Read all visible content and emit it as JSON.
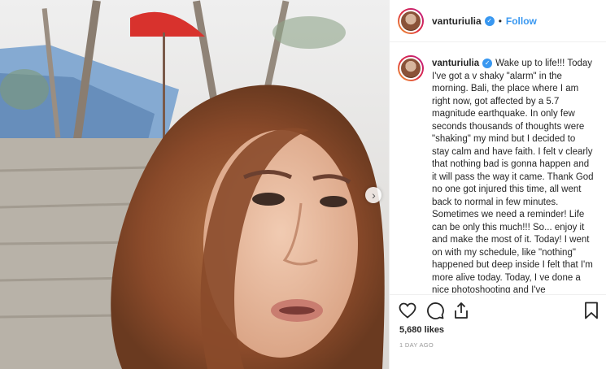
{
  "post": {
    "username": "vanturiulia",
    "follow_label": "Follow",
    "separator": "•",
    "verified_mark": "✓",
    "caption_user": "vanturiulia",
    "caption_text": "Wake up to life!!! Today I've got a v shaky \"alarm\" in the morning. Bali, the place where I am right now, got affected by a 5.7 magnitude earthquake. In only few seconds thousands of thoughts were \"shaking\" my mind but I decided to stay calm and have faith. I felt v clearly that nothing bad is gonna happen and it will pass the way it came. Thank God no one got injured this time, all went back to normal in few minutes. Sometimes we need a reminder! Life can be only this much!!! So... enjoy it and make the most of it. Today! I went on with my schedule, like \"nothing\" happened but deep inside I felt that I'm\nmore alive today. Today, I ve done a nice photoshooting and I've",
    "likes": "5,680 likes",
    "time": "1 DAY AGO"
  },
  "media": {
    "next_glyph": "›"
  },
  "icons": {
    "like": "heart-icon",
    "comment": "comment-icon",
    "share": "share-icon",
    "save": "bookmark-icon",
    "next": "chevron-right-icon"
  },
  "colors": {
    "link_blue": "#3897f0",
    "umbrella_red": "#d8322d",
    "hair": "#8a4a2a"
  }
}
